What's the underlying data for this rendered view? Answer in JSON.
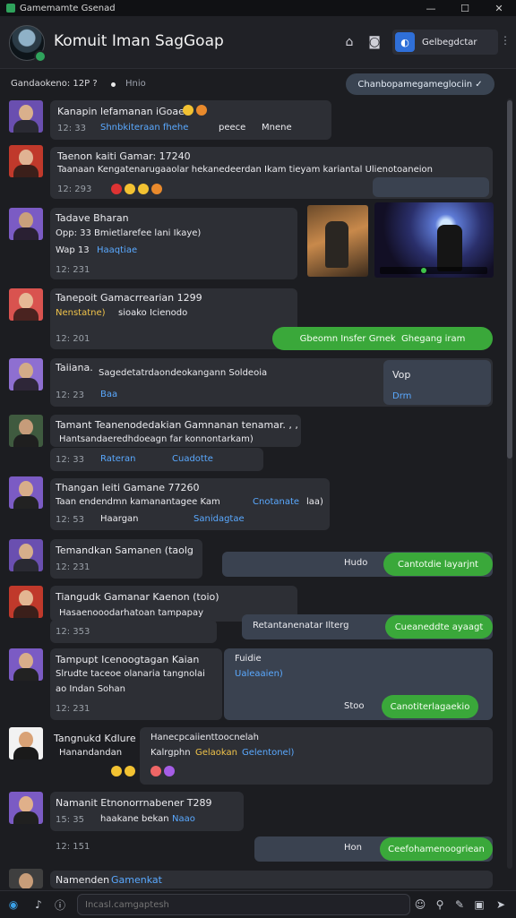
{
  "window": {
    "title": "Gamemamte Gsenad",
    "minimize": "—",
    "maximize": "☐",
    "close": "✕"
  },
  "header": {
    "name": "Komuit Iman SagGoap",
    "chip_label": "Gelbegdctar"
  },
  "status": {
    "left": "Gandaokeno:  12P  ?",
    "right": "Hnio",
    "pill": "Chanbopamegameglociin  ✓"
  },
  "messages": [
    {
      "line1": "Kanapin lefamanan iGoaen",
      "ts": "12:  33",
      "extra": "Shnbkiteraan fhehe",
      "extra2": "peece",
      "extra3": "Mnene"
    },
    {
      "line1": "Taenon kaiti Gamar:  17240",
      "line2": "Taanaan Kengatenarugaaolar hekanedeerdan Ikam tieyam kariantal Ulienotoaneion",
      "ts": "12:  293"
    },
    {
      "line1": "Tadave Bharan",
      "line2": "Opp:  33   Bmietlarefee lani Ikaye)",
      "line3": "Wap  13",
      "link": "Haaqtiae",
      "ts": "12:  231"
    },
    {
      "line1": "Tanepoit Gamacrrearian  1299",
      "gold": "Nenstatne)",
      "line2": "sioako Icienodo",
      "ts": "12:  201",
      "green": "Gbeomn Insfer Grnek",
      "green2": "Ghegang iram"
    },
    {
      "line1": "Taiiana.",
      "line2": "Sagedetatrdaondeokangann Soldeoia",
      "ts": "12:  23",
      "link": "Baa",
      "gray1": "Vop",
      "gray2": "Drm"
    },
    {
      "line1": "Tamant Teanenodedakian Gamnanan tenamar. , ,",
      "line2": "Hantsandaeredhdoeagn far konnontarkam)",
      "ts": "12:  33",
      "link": "Rateran",
      "link2": "Cuadotte"
    },
    {
      "line1": "Thangan Ieiti Gamane  77260",
      "line2": "Taan endendmn kamanantagee Kam",
      "link": "Cnotanate",
      "tail": "laa)",
      "ts": "12:  53",
      "line3": "Haargan",
      "link2": "Sanidagtae"
    },
    {
      "line1": "Temandkan Samanen  (taolg",
      "ts": "12:  231",
      "gray": "Hudo",
      "green": "Cantotdie layarjnt"
    },
    {
      "line1": "Tiangudk Gamanar Kaenon  (toio)",
      "line2": "Hasaenooodarhatoan tampapay",
      "ts": "12:  353",
      "pill": "Retantanenatar  Ilterg",
      "green": "Cueaneddte ayaagt"
    },
    {
      "line1": "Tampupt Icenoogtagan  Kaian",
      "line2": "Slrudte taceoe olanaria tangnolai",
      "line3": "ao Indan Sohan",
      "ts": "12:  231",
      "gray1": "Fuidie",
      "gray2": "Ualeaaien)",
      "gray3": "Stoo",
      "green": "Canotiterlagaekio"
    },
    {
      "line1": "Tangnukd Kdlure",
      "line2": "Hanandandan",
      "box1": "Hanecpcaiienttoocnelah",
      "box2": "Kalrgphn",
      "box_gold": "Gelaokan",
      "box_link": "Gelentonel)"
    },
    {
      "line1": "Namanit Etnonorrnabener  T289",
      "ts": "15:  35",
      "line2": "haakane bekan",
      "link": "Naao",
      "ts2": "12:  151",
      "gray": "Hon",
      "green": "Ceefohamenoogriean"
    },
    {
      "line1": "Namenden",
      "link": "Gamenkat"
    }
  ],
  "composer": {
    "placeholder": "Incasl.camgaptesh"
  },
  "colors": {
    "accent_green": "#3aa83a",
    "link_blue": "#5aa9ff",
    "bubble": "#2d2f35",
    "background": "#1c1d21"
  }
}
